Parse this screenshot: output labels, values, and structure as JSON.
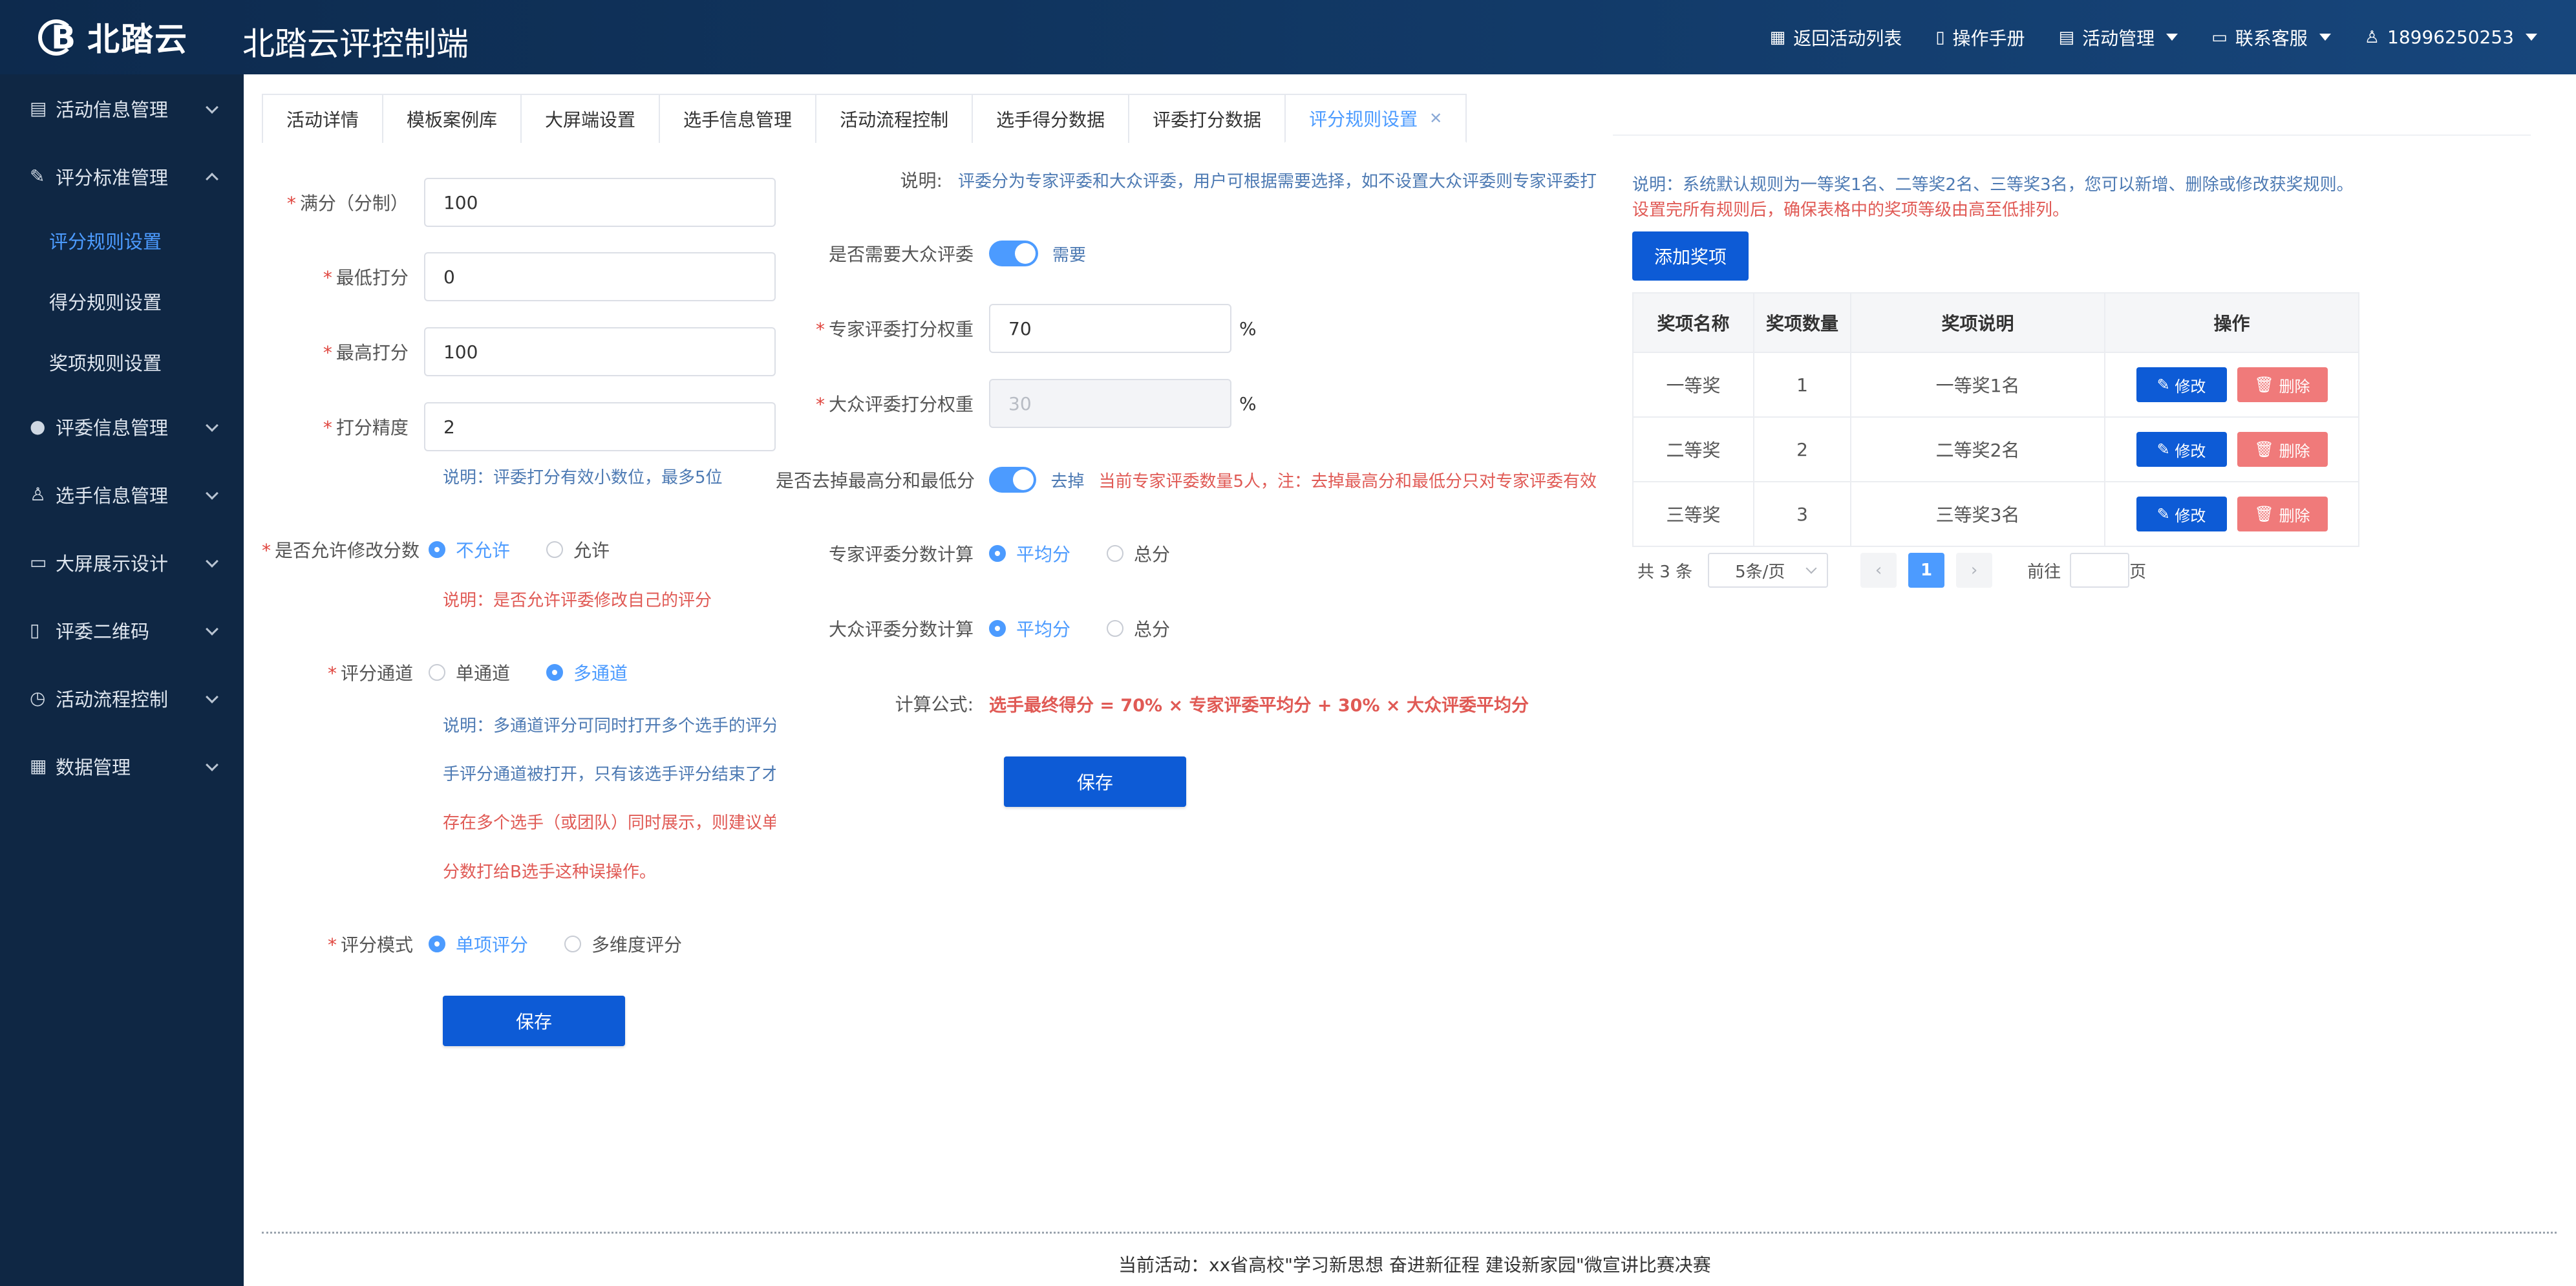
{
  "header": {
    "logo_text": "北踏云",
    "title": "北踏云评控制端",
    "nav": [
      {
        "label": "返回活动列表",
        "icon": "grid-icon"
      },
      {
        "label": "操作手册",
        "icon": "book-icon"
      },
      {
        "label": "活动管理",
        "icon": "document-icon"
      },
      {
        "label": "联系客服",
        "icon": "chat-icon"
      },
      {
        "label": "18996250253",
        "icon": "user-icon"
      }
    ]
  },
  "sidebar": {
    "items": [
      {
        "label": "活动信息管理",
        "icon": "document-icon",
        "expanded": false
      },
      {
        "label": "评分标准管理",
        "icon": "edit-icon",
        "expanded": true
      },
      {
        "label": "评委信息管理",
        "icon": "person-icon",
        "expanded": false
      },
      {
        "label": "选手信息管理",
        "icon": "user-icon",
        "expanded": false
      },
      {
        "label": "大屏展示设计",
        "icon": "monitor-icon",
        "expanded": false
      },
      {
        "label": "评委二维码",
        "icon": "phone-icon",
        "expanded": false
      },
      {
        "label": "活动流程控制",
        "icon": "alarm-icon",
        "expanded": false
      },
      {
        "label": "数据管理",
        "icon": "calendar-icon",
        "expanded": false
      }
    ],
    "sub_items": [
      {
        "label": "评分规则设置",
        "active": true
      },
      {
        "label": "得分规则设置",
        "active": false
      },
      {
        "label": "奖项规则设置",
        "active": false
      }
    ]
  },
  "tabs": [
    {
      "label": "活动详情",
      "active": false
    },
    {
      "label": "模板案例库",
      "active": false
    },
    {
      "label": "大屏端设置",
      "active": false
    },
    {
      "label": "选手信息管理",
      "active": false
    },
    {
      "label": "活动流程控制",
      "active": false
    },
    {
      "label": "选手得分数据",
      "active": false
    },
    {
      "label": "评委打分数据",
      "active": false
    },
    {
      "label": "评分规则设置",
      "active": true
    }
  ],
  "score_form": {
    "full_score_label": "满分（分制）",
    "full_score_value": "100",
    "min_score_label": "最低打分",
    "min_score_value": "0",
    "max_score_label": "最高打分",
    "max_score_value": "100",
    "precision_label": "打分精度",
    "precision_value": "2",
    "precision_note": "说明：评委打分有效小数位，最多5位",
    "allow_edit_label": "是否允许修改分数",
    "allow_edit_options": [
      "不允许",
      "允许"
    ],
    "allow_edit_note": "说明：是否允许评委修改自己的评分",
    "channel_label": "评分通道",
    "channel_options": [
      "单通道",
      "多通道"
    ],
    "channel_note_lines": [
      "说明：多通道评分可同时打开多个选手的评分通",
      "手评分通道被打开，只有该选手评分结束了才能",
      "存在多个选手（或团队）同时展示，则建议单通",
      "分数打给B选手这种误操作。"
    ],
    "mode_label": "评分模式",
    "mode_options": [
      "单项评分",
      "多维度评分"
    ],
    "save_label": "保存"
  },
  "judge_form": {
    "desc_label": "说明:",
    "desc_text": "评委分为专家评委和大众评委，用户可根据需要选择，如不设置大众评委则专家评委打",
    "need_public_label": "是否需要大众评委",
    "need_public_text": "需要",
    "expert_weight_label": "专家评委打分权重",
    "expert_weight_value": "70",
    "public_weight_label": "大众评委打分权重",
    "public_weight_value": "30",
    "percent": "%",
    "remove_extremes_label": "是否去掉最高分和最低分",
    "remove_extremes_text": "去掉",
    "remove_extremes_note": "当前专家评委数量5人，注：去掉最高分和最低分只对专家评委有效",
    "expert_calc_label": "专家评委分数计算",
    "public_calc_label": "大众评委分数计算",
    "calc_options": [
      "平均分",
      "总分"
    ],
    "formula_label": "计算公式:",
    "formula_text": "选手最终得分 = 70% × 专家评委平均分 + 30% × 大众评委平均分",
    "save_label": "保存"
  },
  "prize_panel": {
    "note_blue": "说明：系统默认规则为一等奖1名、二等奖2名、三等奖3名，您可以新增、删除或修改获奖规则。",
    "note_red": "设置完所有规则后，确保表格中的奖项等级由高至低排列。",
    "add_label": "添加奖项",
    "columns": [
      "奖项名称",
      "奖项数量",
      "奖项说明",
      "操作"
    ],
    "rows": [
      {
        "name": "一等奖",
        "count": "1",
        "desc": "一等奖1名"
      },
      {
        "name": "二等奖",
        "count": "2",
        "desc": "二等奖2名"
      },
      {
        "name": "三等奖",
        "count": "3",
        "desc": "三等奖3名"
      }
    ],
    "edit_label": "修改",
    "delete_label": "删除",
    "pager": {
      "total": "共 3 条",
      "page_size": "5条/页",
      "current": "1",
      "goto_label": "前往",
      "page_suffix": "页"
    }
  },
  "footer": {
    "text": "当前活动：xx省高校\"学习新思想 奋进新征程 建设新家园\"微宣讲比赛决赛"
  }
}
